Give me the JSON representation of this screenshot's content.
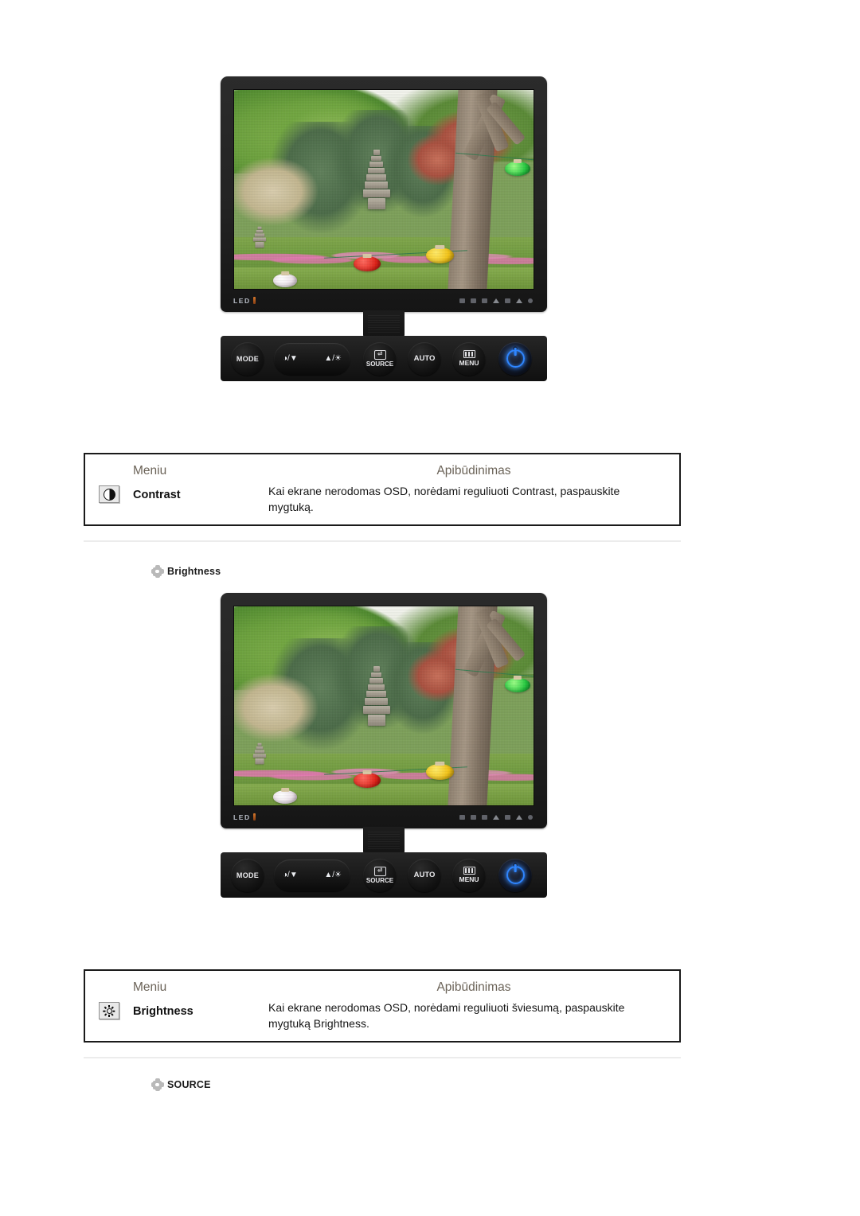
{
  "monitors": [
    {
      "led_label": "LED",
      "buttons": {
        "mode": "MODE",
        "rocker_left": "◑/▼",
        "rocker_right": "▲/☀",
        "source": "SOURCE",
        "auto": "AUTO",
        "menu": "MENU",
        "power": "power-icon"
      }
    },
    {
      "led_label": "LED",
      "buttons": {
        "mode": "MODE",
        "rocker_left": "◑/▼",
        "rocker_right": "▲/☀",
        "source": "SOURCE",
        "auto": "AUTO",
        "menu": "MENU",
        "power": "power-icon"
      }
    }
  ],
  "tables": [
    {
      "header_menu": "Meniu",
      "header_description": "Apibūdinimas",
      "icon": "contrast-icon",
      "menu_name": "Contrast",
      "description": "Kai ekrane nerodomas OSD, norėdami reguliuoti Contrast, paspauskite mygtuką."
    },
    {
      "header_menu": "Meniu",
      "header_description": "Apibūdinimas",
      "icon": "brightness-icon",
      "menu_name": "Brightness",
      "description": "Kai ekrane nerodomas OSD, norėdami reguliuoti šviesumą, paspauskite mygtuką Brightness."
    }
  ],
  "sections": [
    {
      "bullet": "gear-bullet-icon",
      "label": "Brightness"
    },
    {
      "bullet": "gear-bullet-icon",
      "label": "SOURCE"
    }
  ],
  "colors": {
    "header_text": "#6b6358",
    "body_text": "#151515",
    "table_border": "#1a1a1a",
    "rule": "#ececec",
    "power_blue": "#2f86ff",
    "led_orange": "#d4772c"
  }
}
